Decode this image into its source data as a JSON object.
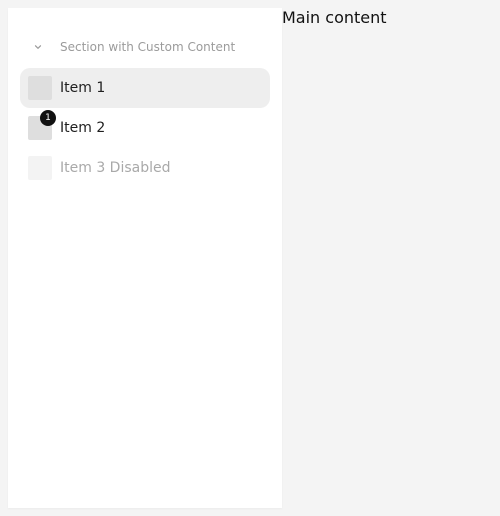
{
  "sidebar": {
    "section": {
      "title": "Section with Custom Content",
      "icon": "chevron-down-icon",
      "expanded": true
    },
    "items": [
      {
        "label": "Item 1",
        "selected": true,
        "disabled": false,
        "badge": ""
      },
      {
        "label": "Item 2",
        "selected": false,
        "disabled": false,
        "badge": "1"
      },
      {
        "label": "Item 3 Disabled",
        "selected": false,
        "disabled": true,
        "badge": ""
      }
    ]
  },
  "main": {
    "title": "Main content"
  },
  "colors": {
    "page_background": "#f4f4f4",
    "sidebar_background": "#ffffff",
    "selected_item_background": "#eeeeee",
    "badge_background": "#111111"
  }
}
